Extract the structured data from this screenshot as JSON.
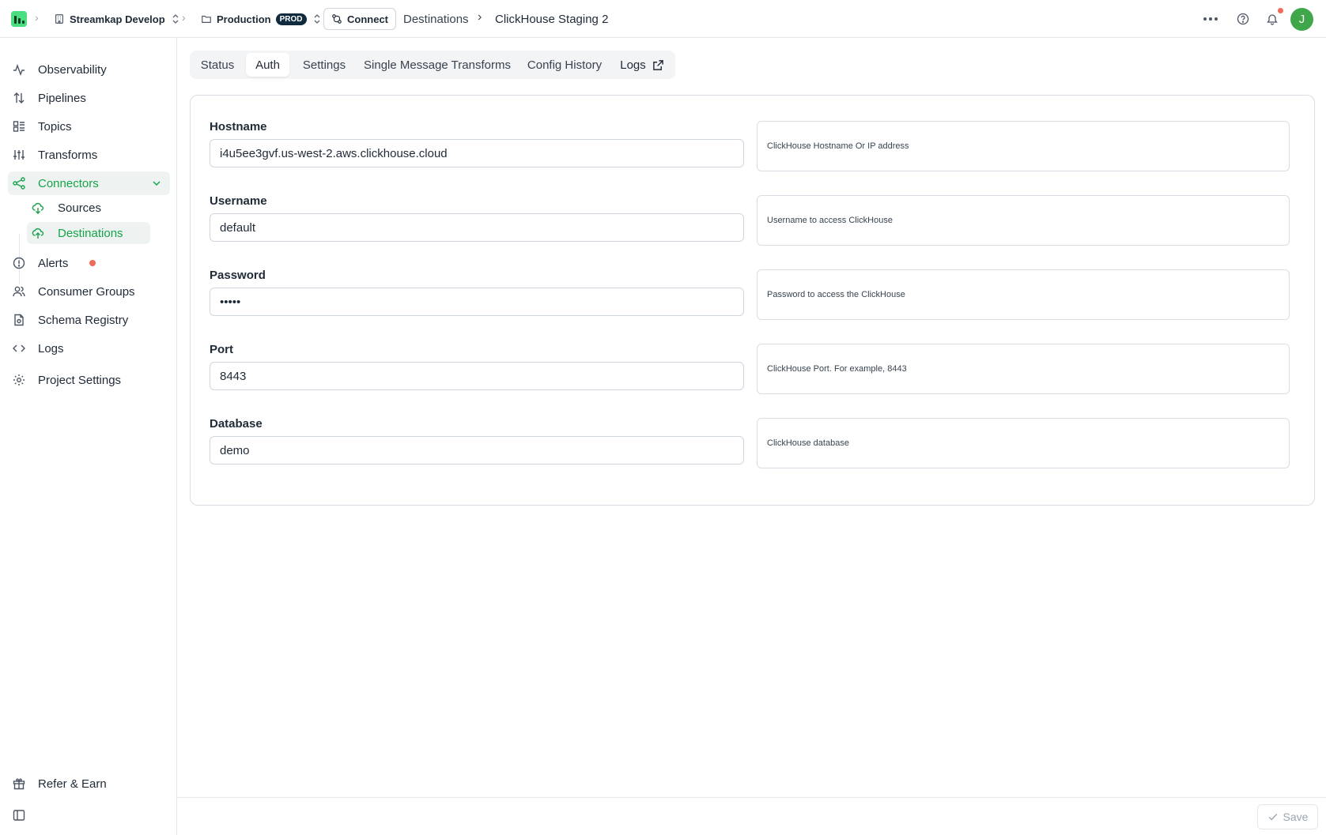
{
  "topbar": {
    "workspace": "Streamkap Develop",
    "environment": "Production",
    "env_badge": "PROD",
    "connect_label": "Connect",
    "breadcrumb_parent": "Destinations",
    "breadcrumb_current": "ClickHouse Staging 2",
    "avatar_initial": "J"
  },
  "sidebar": {
    "items": [
      {
        "label": "Observability",
        "icon": "activity-icon"
      },
      {
        "label": "Pipelines",
        "icon": "arrows-up-down-icon"
      },
      {
        "label": "Topics",
        "icon": "list-icon"
      },
      {
        "label": "Transforms",
        "icon": "sliders-icon"
      },
      {
        "label": "Connectors",
        "icon": "share-icon"
      },
      {
        "label": "Sources",
        "icon": "cloud-download-icon"
      },
      {
        "label": "Destinations",
        "icon": "cloud-upload-icon"
      },
      {
        "label": "Alerts",
        "icon": "alert-circle-icon"
      },
      {
        "label": "Consumer Groups",
        "icon": "users-icon"
      },
      {
        "label": "Schema Registry",
        "icon": "file-icon"
      },
      {
        "label": "Logs",
        "icon": "code-icon"
      },
      {
        "label": "Project Settings",
        "icon": "gear-icon"
      }
    ],
    "refer_label": "Refer & Earn"
  },
  "tabs": [
    {
      "label": "Status"
    },
    {
      "label": "Auth"
    },
    {
      "label": "Settings"
    },
    {
      "label": "Single Message Transforms"
    },
    {
      "label": "Config History"
    },
    {
      "label": "Logs"
    }
  ],
  "form": {
    "fields": [
      {
        "label": "Hostname",
        "value": "i4u5ee3gvf.us-west-2.aws.clickhouse.cloud",
        "help": "ClickHouse Hostname Or IP address"
      },
      {
        "label": "Username",
        "value": "default",
        "help": "Username to access ClickHouse"
      },
      {
        "label": "Password",
        "value": "•••••",
        "help": "Password to access the ClickHouse"
      },
      {
        "label": "Port",
        "value": "8443",
        "help": "ClickHouse Port. For example, 8443"
      },
      {
        "label": "Database",
        "value": "demo",
        "help": "ClickHouse database"
      }
    ]
  },
  "footer": {
    "save_label": "Save"
  },
  "colors": {
    "accent": "#16a34a",
    "brand": "#4ade80",
    "alert": "#ef6a5a"
  }
}
